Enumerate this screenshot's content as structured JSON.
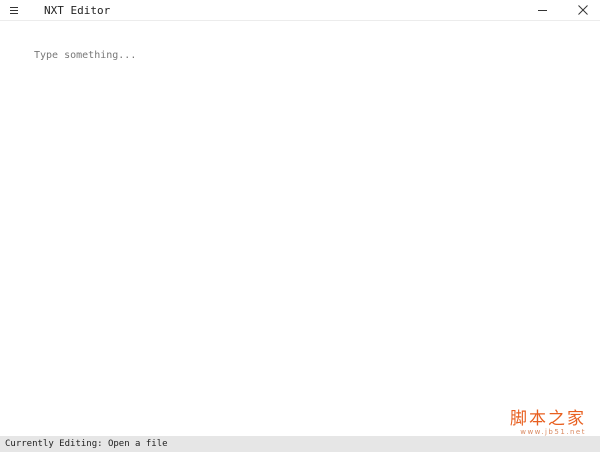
{
  "window": {
    "title": "NXT Editor",
    "menu_icon": "hamburger-menu-icon",
    "minimize_icon": "minimize-icon",
    "close_icon": "close-icon"
  },
  "editor": {
    "value": "",
    "placeholder": "Type something..."
  },
  "watermark": {
    "text": "脚本之家",
    "url": "www.jb51.net"
  },
  "status": {
    "text": "Currently Editing: Open a file"
  },
  "colors": {
    "background": "#ffffff",
    "statusbar": "#e6e6e6",
    "watermark": "#e85f1f"
  }
}
